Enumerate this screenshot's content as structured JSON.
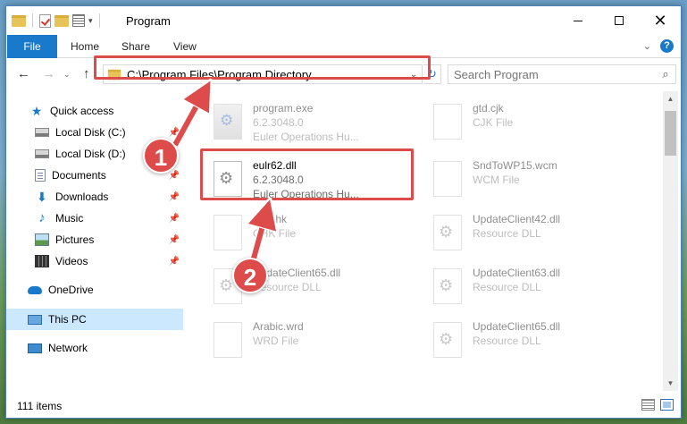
{
  "window": {
    "title": "Program"
  },
  "ribbon": {
    "tabs": [
      "File",
      "Home",
      "Share",
      "View"
    ],
    "help": "?"
  },
  "address": {
    "path": "C:\\Program Files\\Program Directory"
  },
  "search": {
    "placeholder": "Search Program"
  },
  "sidebar": {
    "items": [
      {
        "label": "Quick access",
        "icon": "star-icon",
        "pinned": false
      },
      {
        "label": "Local Disk (C:)",
        "icon": "drive-icon",
        "pinned": true
      },
      {
        "label": "Local Disk (D:)",
        "icon": "drive-icon",
        "pinned": false
      },
      {
        "label": "Documents",
        "icon": "documents-icon",
        "pinned": true
      },
      {
        "label": "Downloads",
        "icon": "download-icon",
        "pinned": true
      },
      {
        "label": "Music",
        "icon": "music-icon",
        "pinned": true
      },
      {
        "label": "Pictures",
        "icon": "pictures-icon",
        "pinned": true
      },
      {
        "label": "Videos",
        "icon": "videos-icon",
        "pinned": true
      },
      {
        "label": "OneDrive",
        "icon": "cloud-icon",
        "pinned": false
      },
      {
        "label": "This PC",
        "icon": "pc-icon",
        "pinned": false,
        "selected": true
      },
      {
        "label": "Network",
        "icon": "network-icon",
        "pinned": false
      }
    ]
  },
  "files": [
    {
      "name": "program.exe",
      "line1": "6.2.3048.0",
      "line2": "Euler Operations Hu...",
      "type": "exe"
    },
    {
      "name": "gtd.cjk",
      "line1": "CJK File",
      "line2": "",
      "type": "doc"
    },
    {
      "name": "eulr62.dll",
      "line1": "6.2.3048.0",
      "line2": "Euler Operations Hu...",
      "type": "dll"
    },
    {
      "name": "SndToWP15.wcm",
      "line1": "WCM File",
      "line2": "",
      "type": "doc"
    },
    {
      "name": "dpl.chk",
      "line1": "CHK File",
      "line2": "",
      "type": "doc"
    },
    {
      "name": "UpdateClient42.dll",
      "line1": "Resource DLL",
      "line2": "",
      "type": "dll"
    },
    {
      "name": "UpdateClient65.dll",
      "line1": "Resource DLL",
      "line2": "",
      "type": "dll"
    },
    {
      "name": "UpdateClient63.dll",
      "line1": "Resource DLL",
      "line2": "",
      "type": "dll"
    },
    {
      "name": "Arabic.wrd",
      "line1": "WRD File",
      "line2": "",
      "type": "doc"
    },
    {
      "name": "UpdateClient65.dll",
      "line1": "Resource DLL",
      "line2": "",
      "type": "dll"
    }
  ],
  "status": {
    "count": "111 items"
  },
  "annotations": {
    "step1": "1",
    "step2": "2"
  },
  "colors": {
    "accent": "#1979ca",
    "highlight": "#dd4b4b",
    "selected": "#cce8ff"
  }
}
